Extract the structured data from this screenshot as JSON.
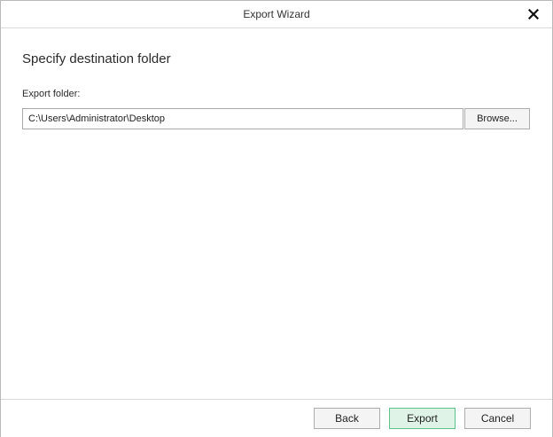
{
  "window": {
    "title": "Export Wizard",
    "close_icon": "close-icon"
  },
  "page": {
    "heading": "Specify destination folder",
    "folder_label": "Export folder:",
    "folder_value": "C:\\Users\\Administrator\\Desktop",
    "browse_label": "Browse..."
  },
  "footer": {
    "back_label": "Back",
    "export_label": "Export",
    "cancel_label": "Cancel"
  },
  "colors": {
    "primary_border": "#5fc28a",
    "primary_fill": "#dff3e6"
  }
}
